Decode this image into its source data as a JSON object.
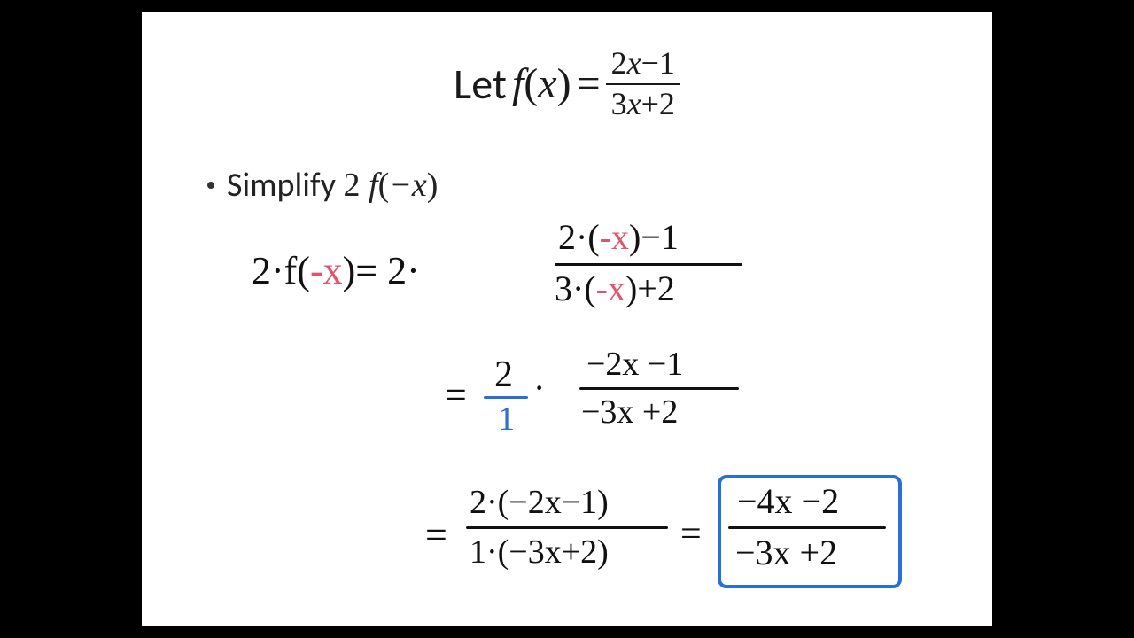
{
  "header": {
    "lead": "Let ",
    "func": "f",
    "arg_open": "(",
    "arg": "x",
    "arg_close": ")",
    "eq": " = ",
    "num_a": "2",
    "num_x": "x",
    "num_b": "−1",
    "den_a": "3",
    "den_x": "x",
    "den_b": "+2"
  },
  "bullet": {
    "text": "Simplify ",
    "coef": "2 ",
    "func": "f",
    "arg_open": "(",
    "arg": "−x",
    "arg_close": ")"
  },
  "hw": {
    "l1_left_a": "2·f(",
    "l1_left_neg": "-x",
    "l1_left_b": ")= 2·",
    "l1_num_a": "2·(",
    "l1_num_neg": "-x",
    "l1_num_b": ")−1",
    "l1_den_a": "3·(",
    "l1_den_neg": "-x",
    "l1_den_b": ")+2",
    "l2_eq": "=",
    "l2_two": "2",
    "l2_dot": "·",
    "l2_one": "1",
    "l2_num": "−2x −1",
    "l2_den": "−3x +2",
    "l3_eq": "=",
    "l3_num": "2·(−2x−1)",
    "l3_den": "1·(−3x+2)",
    "l3_eq2": "=",
    "l3_ans_num": "−4x −2",
    "l3_ans_den": "−3x +2"
  }
}
